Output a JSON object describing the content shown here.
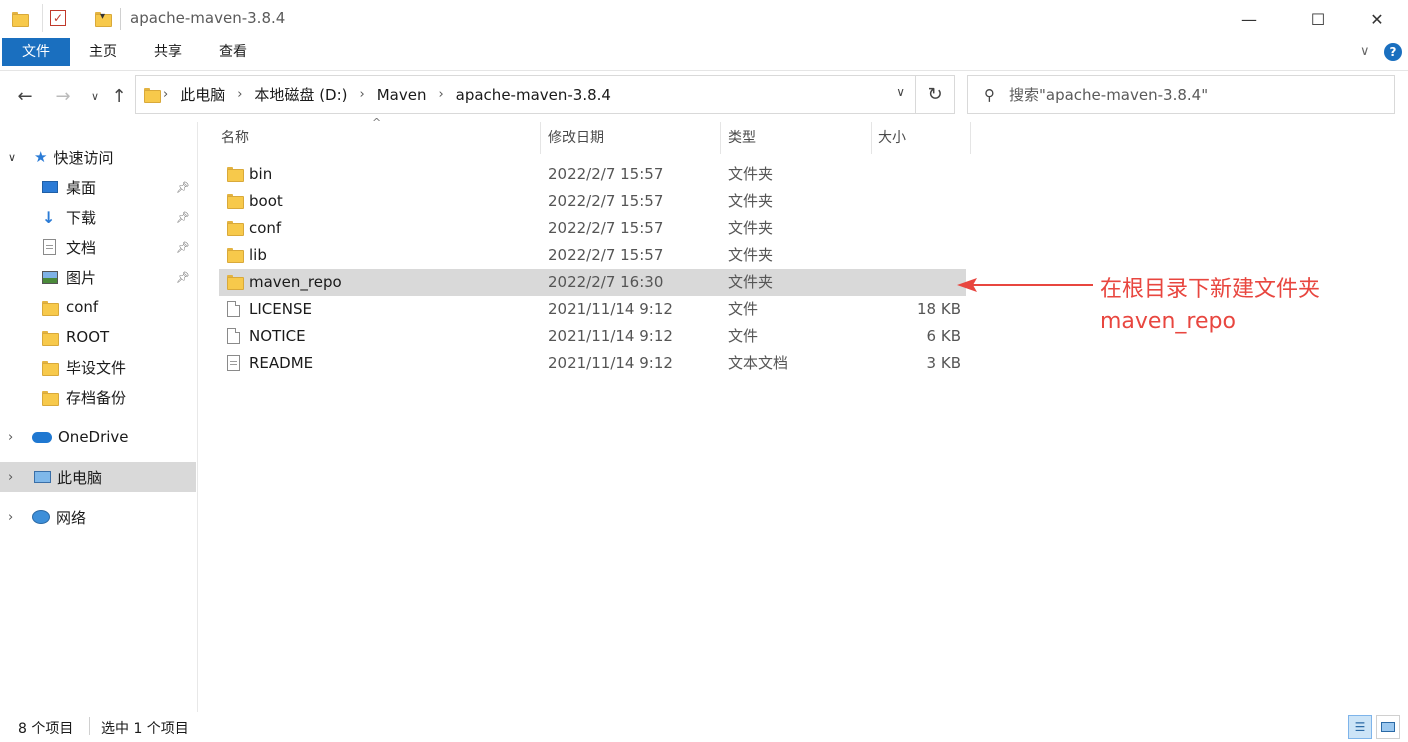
{
  "window": {
    "title": "apache-maven-3.8.4",
    "minimize": "—",
    "maximize": "☐",
    "close": "✕"
  },
  "ribbon": {
    "tabs": [
      "文件",
      "主页",
      "共享",
      "查看"
    ]
  },
  "address": {
    "crumbs": [
      "此电脑",
      "本地磁盘 (D:)",
      "Maven",
      "apache-maven-3.8.4"
    ],
    "search_placeholder": "搜索\"apache-maven-3.8.4\""
  },
  "sidebar": {
    "quick_access": "快速访问",
    "items": [
      {
        "label": "桌面",
        "icon": "desktop-icon",
        "pinned": true
      },
      {
        "label": "下载",
        "icon": "download-icon",
        "pinned": true
      },
      {
        "label": "文档",
        "icon": "document-icon",
        "pinned": true
      },
      {
        "label": "图片",
        "icon": "picture-icon",
        "pinned": true
      },
      {
        "label": "conf",
        "icon": "folder-icon",
        "pinned": false
      },
      {
        "label": "ROOT",
        "icon": "folder-icon",
        "pinned": false
      },
      {
        "label": "毕设文件",
        "icon": "folder-icon",
        "pinned": false
      },
      {
        "label": "存档备份",
        "icon": "folder-icon",
        "pinned": false
      }
    ],
    "onedrive": "OneDrive",
    "this_pc": "此电脑",
    "network": "网络"
  },
  "columns": {
    "name": "名称",
    "date": "修改日期",
    "type": "类型",
    "size": "大小"
  },
  "files": [
    {
      "name": "bin",
      "date": "2022/2/7 15:57",
      "type": "文件夹",
      "size": "",
      "kind": "folder"
    },
    {
      "name": "boot",
      "date": "2022/2/7 15:57",
      "type": "文件夹",
      "size": "",
      "kind": "folder"
    },
    {
      "name": "conf",
      "date": "2022/2/7 15:57",
      "type": "文件夹",
      "size": "",
      "kind": "folder"
    },
    {
      "name": "lib",
      "date": "2022/2/7 15:57",
      "type": "文件夹",
      "size": "",
      "kind": "folder"
    },
    {
      "name": "maven_repo",
      "date": "2022/2/7 16:30",
      "type": "文件夹",
      "size": "",
      "kind": "folder",
      "selected": true
    },
    {
      "name": "LICENSE",
      "date": "2021/11/14 9:12",
      "type": "文件",
      "size": "18 KB",
      "kind": "file"
    },
    {
      "name": "NOTICE",
      "date": "2021/11/14 9:12",
      "type": "文件",
      "size": "6 KB",
      "kind": "file"
    },
    {
      "name": "README",
      "date": "2021/11/14 9:12",
      "type": "文本文档",
      "size": "3 KB",
      "kind": "text"
    }
  ],
  "annotation": {
    "line1": "在根目录下新建文件夹",
    "line2": "maven_repo",
    "color": "#e8463f"
  },
  "status": {
    "count": "8 个项目",
    "selected": "选中 1 个项目"
  }
}
